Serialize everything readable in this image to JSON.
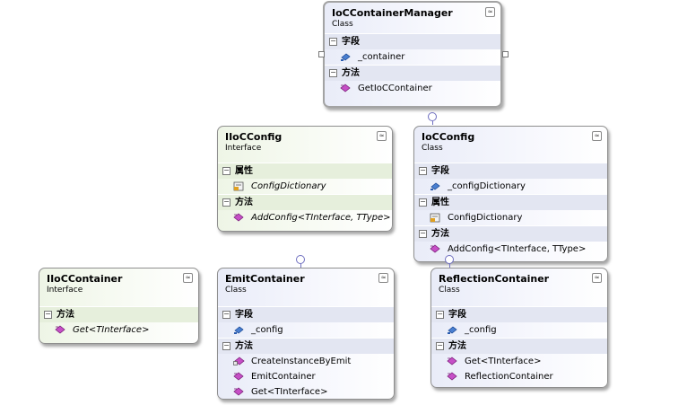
{
  "shapes": {
    "manager": {
      "name": "IoCContainerManager",
      "stereotype": "Class",
      "sections": [
        {
          "label": "字段",
          "members": [
            "_container"
          ]
        },
        {
          "label": "方法",
          "members": [
            "GetIoCContainer"
          ]
        }
      ]
    },
    "iiocconfig": {
      "name": "IIoCConfig",
      "stereotype": "Interface",
      "sections": [
        {
          "label": "属性",
          "members": [
            "ConfigDictionary"
          ]
        },
        {
          "label": "方法",
          "members": [
            "AddConfig<TInterface, TType>"
          ]
        }
      ]
    },
    "iocconfig": {
      "name": "IoCConfig",
      "stereotype": "Class",
      "sections": [
        {
          "label": "字段",
          "members": [
            "_configDictionary"
          ]
        },
        {
          "label": "属性",
          "members": [
            "ConfigDictionary"
          ]
        },
        {
          "label": "方法",
          "members": [
            "AddConfig<TInterface, TType>"
          ]
        }
      ]
    },
    "iioccontainer": {
      "name": "IIoCContainer",
      "stereotype": "Interface",
      "sections": [
        {
          "label": "方法",
          "members": [
            "Get<TInterface>"
          ]
        }
      ]
    },
    "emit": {
      "name": "EmitContainer",
      "stereotype": "Class",
      "sections": [
        {
          "label": "字段",
          "members": [
            "_config"
          ]
        },
        {
          "label": "方法",
          "members": [
            "CreateInstanceByEmit",
            "EmitContainer",
            "Get<TInterface>"
          ]
        }
      ]
    },
    "reflection": {
      "name": "ReflectionContainer",
      "stereotype": "Class",
      "sections": [
        {
          "label": "字段",
          "members": [
            "_config"
          ]
        },
        {
          "label": "方法",
          "members": [
            "Get<TInterface>",
            "ReflectionContainer"
          ]
        }
      ]
    }
  },
  "glyphs": {
    "collapse": "≈",
    "toggle": "−"
  }
}
